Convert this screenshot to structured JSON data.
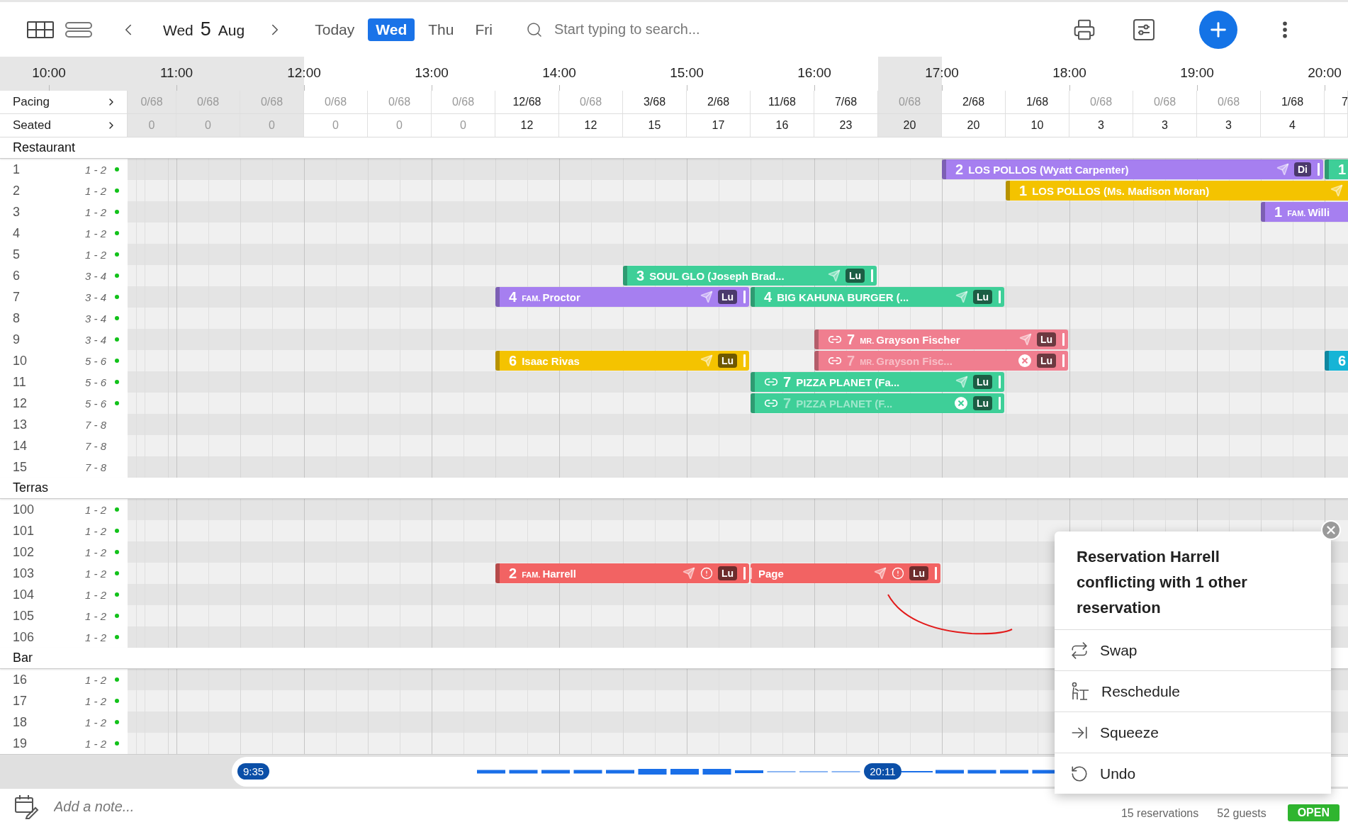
{
  "toolbar": {
    "date": {
      "weekday": "Wed",
      "day": "5",
      "month": "Aug"
    },
    "day_tabs": [
      {
        "label": "Today",
        "selected": false
      },
      {
        "label": "Wed",
        "selected": true
      },
      {
        "label": "Thu",
        "selected": false
      },
      {
        "label": "Fri",
        "selected": false
      }
    ],
    "search": {
      "placeholder": "Start typing to search..."
    }
  },
  "timeline": {
    "hours": [
      "10:00",
      "11:00",
      "12:00",
      "13:00",
      "14:00",
      "15:00",
      "16:00",
      "17:00",
      "18:00",
      "19:00",
      "20:00"
    ],
    "pacing_label": "Pacing",
    "seated_label": "Seated",
    "columns": [
      {
        "pacing": "0/68",
        "seated": "0",
        "shaded": true,
        "muted": true,
        "seated_muted": true
      },
      {
        "pacing": "0/68",
        "seated": "0",
        "shaded": true,
        "muted": true,
        "seated_muted": true
      },
      {
        "pacing": "0/68",
        "seated": "0",
        "shaded": true,
        "muted": true,
        "seated_muted": true
      },
      {
        "pacing": "0/68",
        "seated": "0",
        "shaded": false,
        "muted": true,
        "seated_muted": true
      },
      {
        "pacing": "0/68",
        "seated": "0",
        "shaded": false,
        "muted": true,
        "seated_muted": true
      },
      {
        "pacing": "0/68",
        "seated": "0",
        "shaded": false,
        "muted": true,
        "seated_muted": true
      },
      {
        "pacing": "12/68",
        "seated": "12",
        "shaded": false,
        "muted": false,
        "seated_muted": false
      },
      {
        "pacing": "0/68",
        "seated": "12",
        "shaded": false,
        "muted": true,
        "seated_muted": false
      },
      {
        "pacing": "3/68",
        "seated": "15",
        "shaded": false,
        "muted": false,
        "seated_muted": false
      },
      {
        "pacing": "2/68",
        "seated": "17",
        "shaded": false,
        "muted": false,
        "seated_muted": false
      },
      {
        "pacing": "11/68",
        "seated": "16",
        "shaded": false,
        "muted": false,
        "seated_muted": false
      },
      {
        "pacing": "7/68",
        "seated": "23",
        "shaded": false,
        "muted": false,
        "seated_muted": false
      },
      {
        "pacing": "0/68",
        "seated": "20",
        "shaded": true,
        "muted": true,
        "seated_muted": false
      },
      {
        "pacing": "2/68",
        "seated": "20",
        "shaded": false,
        "muted": false,
        "seated_muted": false
      },
      {
        "pacing": "1/68",
        "seated": "10",
        "shaded": false,
        "muted": false,
        "seated_muted": false
      },
      {
        "pacing": "0/68",
        "seated": "3",
        "shaded": false,
        "muted": true,
        "seated_muted": false
      },
      {
        "pacing": "0/68",
        "seated": "3",
        "shaded": false,
        "muted": true,
        "seated_muted": false
      },
      {
        "pacing": "0/68",
        "seated": "3",
        "shaded": false,
        "muted": true,
        "seated_muted": false
      },
      {
        "pacing": "1/68",
        "seated": "4",
        "shaded": false,
        "muted": false,
        "seated_muted": false
      },
      {
        "pacing": "7",
        "shaded": false,
        "muted": false
      }
    ]
  },
  "sections": [
    {
      "name": "Restaurant",
      "tables": [
        {
          "name": "1",
          "capacity": "1 - 2",
          "indicator": true,
          "reservations": [
            {
              "guests": "2",
              "name": "LOS POLLOS (Wyatt Carpenter)",
              "color": "#a67ff0",
              "sent": true,
              "linked": false,
              "cancelled": false,
              "warning": false,
              "faded": false,
              "continuation": false,
              "shift": "Di"
            },
            {
              "guests": "1",
              "color": "#3ecf98",
              "linked": false,
              "faded": false,
              "continuation": false
            }
          ]
        },
        {
          "name": "2",
          "capacity": "1 - 2",
          "indicator": true,
          "reservations": [
            {
              "guests": "1",
              "name": "LOS POLLOS (Ms. Madison Moran)",
              "color": "#f4c300",
              "sent": true,
              "linked": false,
              "cancelled": false,
              "warning": false,
              "faded": false,
              "continuation": false
            }
          ]
        },
        {
          "name": "3",
          "capacity": "1 - 2",
          "indicator": true,
          "reservations": [
            {
              "guests": "1",
              "prefix": "FAM.",
              "name": "Willi",
              "color": "#a67ff0",
              "linked": false,
              "faded": false,
              "continuation": false
            }
          ]
        },
        {
          "name": "4",
          "capacity": "1 - 2",
          "indicator": true
        },
        {
          "name": "5",
          "capacity": "1 - 2",
          "indicator": true
        },
        {
          "name": "6",
          "capacity": "3 - 4",
          "indicator": true,
          "reservations": [
            {
              "guests": "3",
              "name": "SOUL GLO (Joseph Brad...",
              "color": "#3ecf98",
              "sent": true,
              "linked": false,
              "cancelled": false,
              "warning": false,
              "faded": false,
              "continuation": false,
              "shift": "Lu"
            }
          ]
        },
        {
          "name": "7",
          "capacity": "3 - 4",
          "indicator": true,
          "reservations": [
            {
              "guests": "4",
              "prefix": "FAM.",
              "name": "Proctor",
              "color": "#a67ff0",
              "sent": true,
              "linked": false,
              "cancelled": false,
              "warning": false,
              "faded": false,
              "continuation": false,
              "shift": "Lu"
            },
            {
              "guests": "4",
              "name": "BIG KAHUNA BURGER (...",
              "color": "#3ecf98",
              "sent": true,
              "linked": false,
              "cancelled": false,
              "warning": false,
              "faded": false,
              "continuation": false,
              "shift": "Lu"
            }
          ]
        },
        {
          "name": "8",
          "capacity": "3 - 4",
          "indicator": true
        },
        {
          "name": "9",
          "capacity": "3 - 4",
          "indicator": true,
          "reservations": [
            {
              "guests": "7",
              "prefix": "MR.",
              "name": "Grayson Fischer",
              "color": "#f07e8f",
              "sent": true,
              "linked": true,
              "cancelled": false,
              "warning": false,
              "faded": false,
              "continuation": false,
              "shift": "Lu"
            }
          ]
        },
        {
          "name": "10",
          "capacity": "5 - 6",
          "indicator": true,
          "reservations": [
            {
              "guests": "6",
              "name": "Isaac Rivas",
              "color": "#f4c300",
              "sent": true,
              "linked": false,
              "cancelled": false,
              "warning": false,
              "faded": false,
              "continuation": false,
              "shift": "Lu"
            },
            {
              "guests": "7",
              "prefix": "MR.",
              "name": "Grayson Fisc...",
              "color": "#f07e8f",
              "sent": false,
              "linked": true,
              "cancelled": true,
              "warning": false,
              "faded": true,
              "continuation": false,
              "shift": "Lu"
            },
            {
              "guests": "6",
              "color": "#16b4d6",
              "linked": false,
              "faded": false,
              "continuation": false
            }
          ]
        },
        {
          "name": "11",
          "capacity": "5 - 6",
          "indicator": true,
          "reservations": [
            {
              "guests": "7",
              "name": "PIZZA PLANET (Fa...",
              "color": "#3ecf98",
              "sent": true,
              "linked": true,
              "cancelled": false,
              "warning": false,
              "faded": false,
              "continuation": false,
              "shift": "Lu"
            }
          ]
        },
        {
          "name": "12",
          "capacity": "5 - 6",
          "indicator": true,
          "reservations": [
            {
              "guests": "7",
              "name": "PIZZA PLANET (F...",
              "color": "#3ecf98",
              "sent": false,
              "linked": true,
              "cancelled": true,
              "warning": false,
              "faded": true,
              "continuation": false,
              "shift": "Lu"
            }
          ]
        },
        {
          "name": "13",
          "capacity": "7 - 8",
          "indicator": false
        },
        {
          "name": "14",
          "capacity": "7 - 8",
          "indicator": false
        },
        {
          "name": "15",
          "capacity": "7 - 8",
          "indicator": false
        }
      ]
    },
    {
      "name": "Terras",
      "tables": [
        {
          "name": "100",
          "capacity": "1 - 2",
          "indicator": true
        },
        {
          "name": "101",
          "capacity": "1 - 2",
          "indicator": true
        },
        {
          "name": "102",
          "capacity": "1 - 2",
          "indicator": true
        },
        {
          "name": "103",
          "capacity": "1 - 2",
          "indicator": true,
          "reservations": [
            {
              "guests": "2",
              "prefix": "FAM.",
              "name": "Harrell",
              "color": "#f26363",
              "sent": true,
              "linked": false,
              "cancelled": false,
              "warning": true,
              "faded": false,
              "continuation": false,
              "shift": "Lu"
            },
            {
              "name": "Page",
              "color": "#f26363",
              "sent": true,
              "linked": false,
              "cancelled": false,
              "warning": true,
              "faded": false,
              "continuation": true,
              "shift": "Lu"
            }
          ]
        },
        {
          "name": "104",
          "capacity": "1 - 2",
          "indicator": true
        },
        {
          "name": "105",
          "capacity": "1 - 2",
          "indicator": true
        },
        {
          "name": "106",
          "capacity": "1 - 2",
          "indicator": true
        }
      ]
    },
    {
      "name": "Bar",
      "tables": [
        {
          "name": "16",
          "capacity": "1 - 2",
          "indicator": true
        },
        {
          "name": "17",
          "capacity": "1 - 2",
          "indicator": true
        },
        {
          "name": "18",
          "capacity": "1 - 2",
          "indicator": true
        },
        {
          "name": "19",
          "capacity": "1 - 2",
          "indicator": true
        }
      ]
    }
  ],
  "scrubber": {
    "start": "9:35",
    "current": "20:11"
  },
  "footer": {
    "note_placeholder": "Add a note...",
    "reservations": "15 reservations",
    "guests": "52 guests",
    "status": "OPEN"
  },
  "popup": {
    "title": "Reservation Harrell conflicting with 1 other reservation",
    "actions": [
      {
        "kind": "swap",
        "label": "Swap"
      },
      {
        "kind": "reschedule",
        "label": "Reschedule"
      },
      {
        "kind": "squeeze",
        "label": "Squeeze"
      },
      {
        "kind": "undo",
        "label": "Undo"
      }
    ]
  }
}
